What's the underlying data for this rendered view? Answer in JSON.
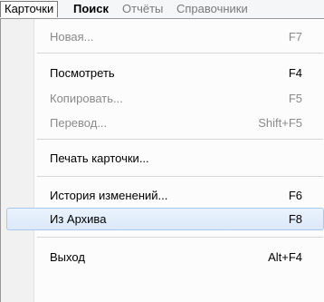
{
  "menubar": {
    "items": [
      {
        "label": "Карточки",
        "state": "active"
      },
      {
        "label": "Поиск",
        "state": "enabled"
      },
      {
        "label": "Отчёты",
        "state": "disabled"
      },
      {
        "label": "Справочники",
        "state": "disabled"
      }
    ]
  },
  "dropdown": {
    "items": [
      {
        "label": "Новая...",
        "shortcut": "F7",
        "enabled": false
      },
      {
        "label": "Посмотреть",
        "shortcut": "F4",
        "enabled": true
      },
      {
        "label": "Копировать...",
        "shortcut": "F5",
        "enabled": false
      },
      {
        "label": "Перевод...",
        "shortcut": "Shift+F5",
        "enabled": false
      },
      {
        "label": "Печать карточки...",
        "shortcut": "",
        "enabled": true
      },
      {
        "label": "История изменений...",
        "shortcut": "F6",
        "enabled": true
      },
      {
        "label": "Из Архива",
        "shortcut": "F8",
        "enabled": true,
        "highlighted": true
      },
      {
        "label": "Выход",
        "shortcut": "Alt+F4",
        "enabled": true
      }
    ]
  },
  "colors": {
    "highlight_border": "#a8c8ee",
    "highlight_fill": "#dce9f9",
    "disabled_text": "#8a8a8a"
  }
}
